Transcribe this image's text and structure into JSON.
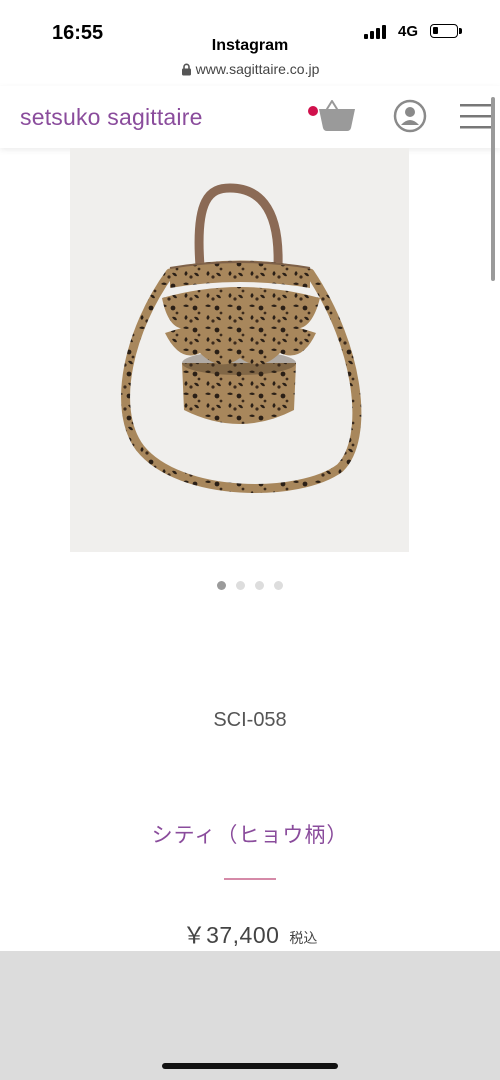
{
  "status_bar": {
    "time": "16:55",
    "app": "Instagram",
    "url": "www.sagittaire.co.jp",
    "network": "4G",
    "battery_level": 0.25
  },
  "header": {
    "brand": "setsuko sagittaire",
    "brand_color": "#8a4c9c",
    "cart_icon": "basket-icon",
    "cart_indicator_color": "#d0104c",
    "account_icon": "account-icon",
    "menu_icon": "hamburger-menu-icon"
  },
  "product": {
    "image_alt_icon": "leopard-bucket-bag-image",
    "carousel": {
      "count": 4,
      "active_index": 0
    },
    "code": "SCI-058",
    "name": "シティ（ヒョウ柄）",
    "price": "￥37,400",
    "tax_label": "税込"
  }
}
